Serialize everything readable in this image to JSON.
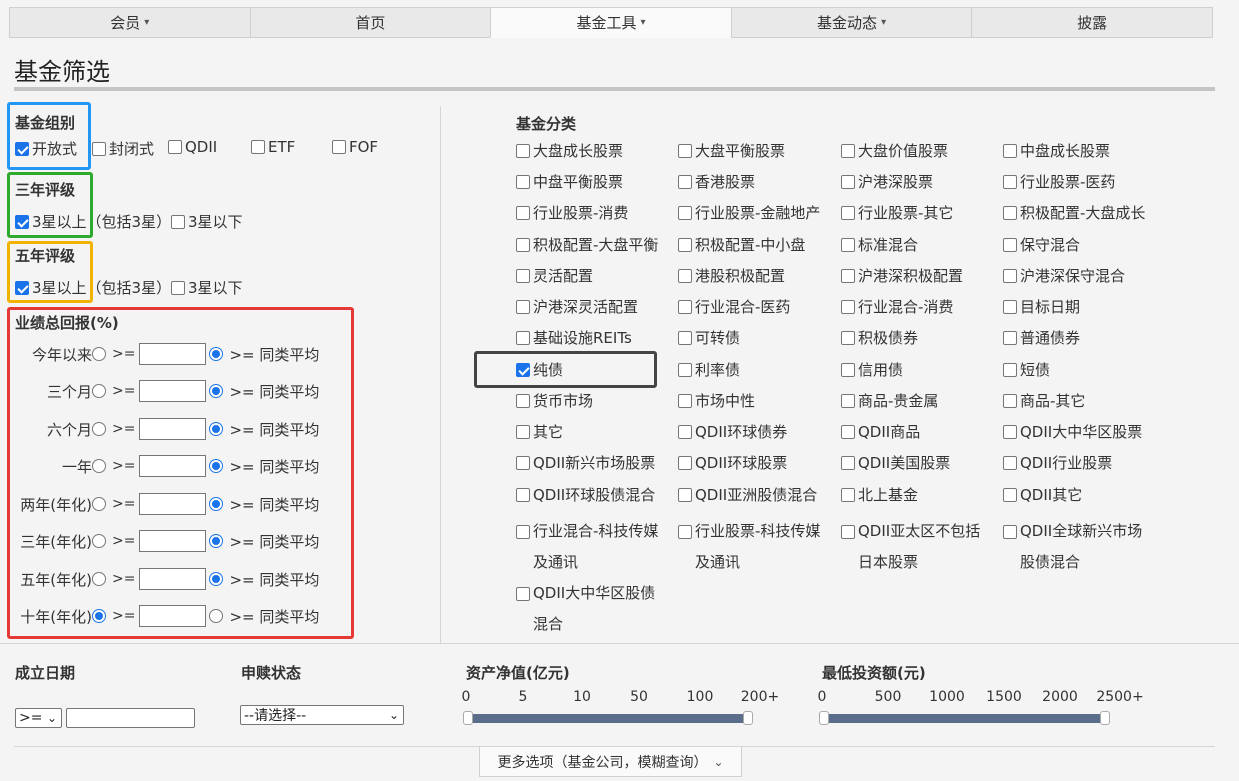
{
  "nav": {
    "tabs": [
      {
        "label": "会员",
        "has_caret": true
      },
      {
        "label": "首页",
        "has_caret": false
      },
      {
        "label": "基金工具",
        "has_caret": true
      },
      {
        "label": "基金动态",
        "has_caret": true
      },
      {
        "label": "披露",
        "has_caret": false
      }
    ],
    "active_index": 2
  },
  "page_title": "基金筛选",
  "fund_group": {
    "label": "基金组别",
    "options": [
      {
        "label": "开放式",
        "checked": true
      },
      {
        "label": "封闭式",
        "checked": false
      },
      {
        "label": "QDII",
        "checked": false
      },
      {
        "label": "ETF",
        "checked": false
      },
      {
        "label": "FOF",
        "checked": false
      }
    ]
  },
  "rating3": {
    "label": "三年评级",
    "options": [
      {
        "label": "3星以上（包括3星）",
        "checked": true
      },
      {
        "label": "3星以下",
        "checked": false
      }
    ]
  },
  "rating5": {
    "label": "五年评级",
    "options": [
      {
        "label": "3星以上（包括3星）",
        "checked": true
      },
      {
        "label": "3星以下",
        "checked": false
      }
    ]
  },
  "performance": {
    "label": "业绩总回报(%)",
    "ge_text": ">=",
    "avg_text": ">= 同类平均",
    "rows": [
      {
        "label": "今年以来",
        "ge_selected": false,
        "value": ""
      },
      {
        "label": "三个月",
        "ge_selected": false,
        "value": ""
      },
      {
        "label": "六个月",
        "ge_selected": false,
        "value": ""
      },
      {
        "label": "一年",
        "ge_selected": false,
        "value": ""
      },
      {
        "label": "两年(年化)",
        "ge_selected": false,
        "value": ""
      },
      {
        "label": "三年(年化)",
        "ge_selected": false,
        "value": ""
      },
      {
        "label": "五年(年化)",
        "ge_selected": false,
        "value": ""
      },
      {
        "label": "十年(年化)",
        "ge_selected": true,
        "value": ""
      }
    ]
  },
  "categories": {
    "label": "基金分类",
    "items": [
      {
        "label": "大盘成长股票",
        "checked": false
      },
      {
        "label": "大盘平衡股票",
        "checked": false
      },
      {
        "label": "大盘价值股票",
        "checked": false
      },
      {
        "label": "中盘成长股票",
        "checked": false
      },
      {
        "label": "中盘平衡股票",
        "checked": false
      },
      {
        "label": "香港股票",
        "checked": false
      },
      {
        "label": "沪港深股票",
        "checked": false
      },
      {
        "label": "行业股票-医药",
        "checked": false
      },
      {
        "label": "行业股票-消费",
        "checked": false
      },
      {
        "label": "行业股票-金融地产",
        "checked": false
      },
      {
        "label": "行业股票-其它",
        "checked": false
      },
      {
        "label": "积极配置-大盘成长",
        "checked": false
      },
      {
        "label": "积极配置-大盘平衡",
        "checked": false
      },
      {
        "label": "积极配置-中小盘",
        "checked": false
      },
      {
        "label": "标准混合",
        "checked": false
      },
      {
        "label": "保守混合",
        "checked": false
      },
      {
        "label": "灵活配置",
        "checked": false
      },
      {
        "label": "港股积极配置",
        "checked": false
      },
      {
        "label": "沪港深积极配置",
        "checked": false
      },
      {
        "label": "沪港深保守混合",
        "checked": false
      },
      {
        "label": "沪港深灵活配置",
        "checked": false
      },
      {
        "label": "行业混合-医药",
        "checked": false
      },
      {
        "label": "行业混合-消费",
        "checked": false
      },
      {
        "label": "目标日期",
        "checked": false
      },
      {
        "label": "基础设施REITs",
        "checked": false
      },
      {
        "label": "可转债",
        "checked": false
      },
      {
        "label": "积极债券",
        "checked": false
      },
      {
        "label": "普通债券",
        "checked": false
      },
      {
        "label": "纯债",
        "checked": true
      },
      {
        "label": "利率债",
        "checked": false
      },
      {
        "label": "信用债",
        "checked": false
      },
      {
        "label": "短债",
        "checked": false
      },
      {
        "label": "货币市场",
        "checked": false
      },
      {
        "label": "市场中性",
        "checked": false
      },
      {
        "label": "商品-贵金属",
        "checked": false
      },
      {
        "label": "商品-其它",
        "checked": false
      },
      {
        "label": "其它",
        "checked": false
      },
      {
        "label": "QDII环球债券",
        "checked": false
      },
      {
        "label": "QDII商品",
        "checked": false
      },
      {
        "label": "QDII大中华区股票",
        "checked": false
      },
      {
        "label": "QDII新兴市场股票",
        "checked": false
      },
      {
        "label": "QDII环球股票",
        "checked": false
      },
      {
        "label": "QDII美国股票",
        "checked": false
      },
      {
        "label": "QDII行业股票",
        "checked": false
      },
      {
        "label": "QDII环球股债混合",
        "checked": false
      },
      {
        "label": "QDII亚洲股债混合",
        "checked": false
      },
      {
        "label": "北上基金",
        "checked": false
      },
      {
        "label": "QDII其它",
        "checked": false
      },
      {
        "label": "行业混合-科技传媒\n及通讯",
        "checked": false
      },
      {
        "label": "行业股票-科技传媒\n及通讯",
        "checked": false
      },
      {
        "label": "QDII亚太区不包括\n日本股票",
        "checked": false
      },
      {
        "label": "QDII全球新兴市场\n股债混合",
        "checked": false
      },
      {
        "label": "QDII大中华区股债\n混合",
        "checked": false
      }
    ]
  },
  "inception": {
    "label": "成立日期",
    "operator": ">=",
    "date_value": ""
  },
  "subscription": {
    "label": "申赎状态",
    "selected": "--请选择--"
  },
  "net_assets": {
    "label": "资产净值(亿元)",
    "ticks": [
      "0",
      "5",
      "10",
      "50",
      "100",
      "200+"
    ],
    "range": [
      "0",
      "200+"
    ]
  },
  "min_investment": {
    "label": "最低投资额(元)",
    "ticks": [
      "0",
      "500",
      "1000",
      "1500",
      "2000",
      "2500+"
    ],
    "range": [
      "0",
      "2500+"
    ]
  },
  "more_options": {
    "label": "更多选项（基金公司，模糊查询）"
  }
}
